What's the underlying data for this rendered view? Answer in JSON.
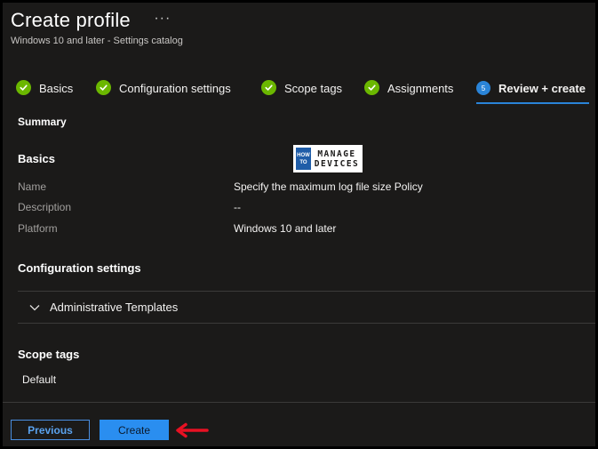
{
  "header": {
    "title": "Create profile",
    "more_label": "···",
    "subtitle": "Windows 10 and later - Settings catalog"
  },
  "tabs": [
    {
      "label": "Basics",
      "state": "complete"
    },
    {
      "label": "Configuration settings",
      "state": "complete"
    },
    {
      "label": "Scope tags",
      "state": "complete"
    },
    {
      "label": "Assignments",
      "state": "complete"
    },
    {
      "label": "Review + create",
      "state": "active",
      "step": "5"
    }
  ],
  "summary_label": "Summary",
  "logo": {
    "how": "HOW",
    "to": "TO",
    "manage": "MANAGE",
    "devices": "DEVICES"
  },
  "basics": {
    "heading": "Basics",
    "fields": [
      {
        "label": "Name",
        "value": "Specify the maximum log file size Policy"
      },
      {
        "label": "Description",
        "value": "--"
      },
      {
        "label": "Platform",
        "value": "Windows 10 and later"
      }
    ]
  },
  "configuration": {
    "heading": "Configuration settings",
    "accordion_label": "Administrative Templates"
  },
  "scope_tags": {
    "heading": "Scope tags",
    "value": "Default"
  },
  "footer": {
    "previous_label": "Previous",
    "create_label": "Create"
  },
  "colors": {
    "background": "#1b1a19",
    "check_green": "#6bb700",
    "accent_blue": "#2a84d8",
    "annotation_red": "#e81123"
  }
}
